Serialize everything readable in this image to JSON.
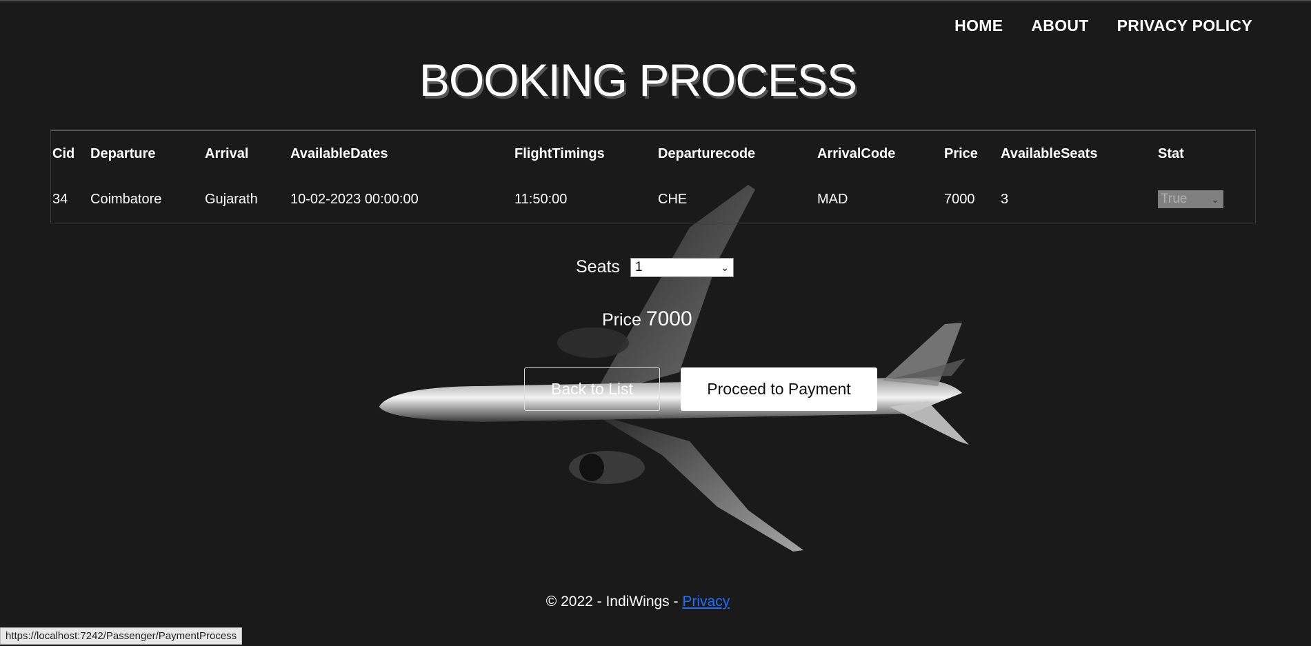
{
  "nav": {
    "home": "HOME",
    "about": "ABOUT",
    "privacy": "PRIVACY POLICY"
  },
  "page": {
    "title": "BOOKING PROCESS"
  },
  "table": {
    "headers": [
      "Cid",
      "Departure",
      "Arrival",
      "AvailableDates",
      "FlightTimings",
      "Departurecode",
      "ArrivalCode",
      "Price",
      "AvailableSeats",
      "Stat"
    ],
    "row": {
      "cid": "34",
      "departure": "Coimbatore",
      "arrival": "Gujarath",
      "available_dates": "10-02-2023 00:00:00",
      "flight_timings": "11:50:00",
      "departure_code": "CHE",
      "arrival_code": "MAD",
      "price": "7000",
      "available_seats": "3",
      "stat": "True"
    }
  },
  "booking": {
    "seats_label": "Seats",
    "seats_value": "1",
    "price_label": "Price",
    "price_value": "7000"
  },
  "buttons": {
    "back": "Back to List",
    "pay": "Proceed to Payment"
  },
  "footer": {
    "text": "© 2022 - IndiWings - ",
    "link": "Privacy"
  },
  "status_url": "https://localhost:7242/Passenger/PaymentProcess",
  "icons": {
    "dropdown": "chevron-down-icon"
  }
}
